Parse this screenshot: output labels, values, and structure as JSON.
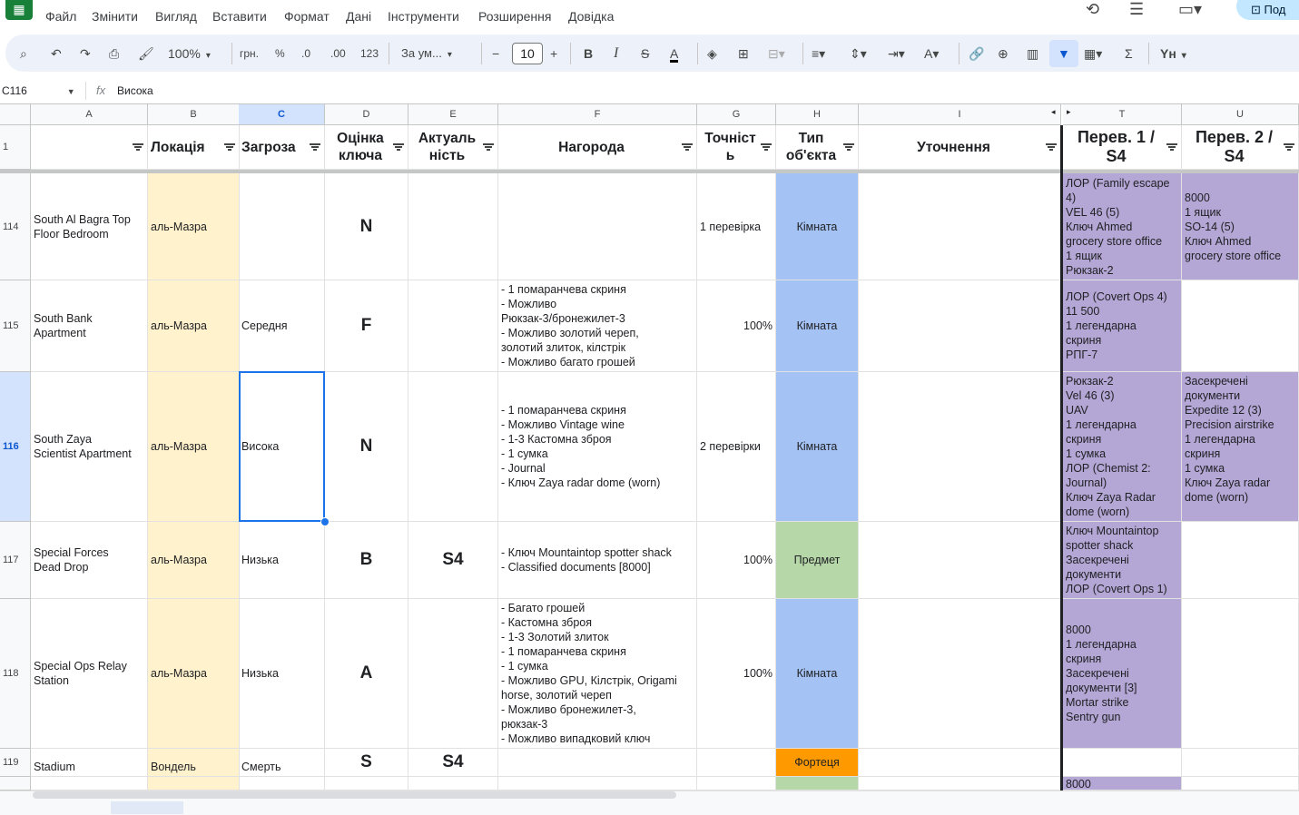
{
  "menu": [
    "Файл",
    "Змінити",
    "Вигляд",
    "Вставити",
    "Формат",
    "Дані",
    "Інструменти",
    "Розширення",
    "Довідка"
  ],
  "share_label": "Под",
  "toolbar": {
    "zoom": "100%",
    "currency": "грн.",
    "percent": "%",
    "dec_decrease": ".0",
    "dec_increase": ".00",
    "number_format": "123",
    "font": "За ум...",
    "font_size": "10",
    "bold": "B",
    "italic": "I",
    "strike": "S",
    "text_color": "A",
    "sum": "Σ",
    "input_tools": "Yн"
  },
  "formula_bar": {
    "cell_ref": "C116",
    "fx": "fx",
    "value": "Висока"
  },
  "columns": [
    "A",
    "B",
    "C",
    "D",
    "E",
    "F",
    "G",
    "H",
    "I",
    "T",
    "U"
  ],
  "header_row": {
    "num": "1",
    "A": "",
    "B": "Локація",
    "C": "Загроза",
    "D": "Оцінка\nключа",
    "E": "Актуаль\nність",
    "F": "Нагорода",
    "G": "Точніст\nь",
    "H": "Тип\nоб'єкта",
    "I": "Уточнення",
    "T": "Перев. 1 /\nS4",
    "U": "Перев. 2 /\nS4"
  },
  "rows": [
    {
      "num": "114",
      "A": "South Al Bagra Top\nFloor Bedroom",
      "B": "аль-Мазра",
      "C": "",
      "D": "N",
      "E": "",
      "F": "",
      "G": "1 перевірка",
      "H": "Кімната",
      "T": "ЛОР (Family escape\n4)\nVEL 46 (5)\nКлюч Ahmed\ngrocery store office\n1 ящик\nРюкзак-2",
      "U": "8000\n1 ящик\nSO-14 (5)\nКлюч Ahmed\ngrocery store office"
    },
    {
      "num": "115",
      "A": "South Bank\nApartment",
      "B": "аль-Мазра",
      "C": "Середня",
      "D": "F",
      "E": "",
      "F": "- 1 помаранчева скриня\n- Можливо\nРюкзак-3/бронежилет-3\n- Можливо золотий череп,\nзолотий злиток, кілстрік\n- Можливо багато грошей",
      "G": "100%",
      "H": "Кімната",
      "T": "ЛОР (Covert Ops 4)\n11 500\n1 легендарна\nскриня\nРПГ-7",
      "U": ""
    },
    {
      "num": "116",
      "A": "South Zaya\nScientist Apartment",
      "B": "аль-Мазра",
      "C": "Висока",
      "D": "N",
      "E": "",
      "F": "- 1 помаранчева скриня\n- Можливо Vintage wine\n- 1-3 Кастомна зброя\n- 1 сумка\n- Journal\n- Ключ Zaya radar dome (worn)",
      "G": "2 перевірки",
      "H": "Кімната",
      "T": "Рюкзак-2\nVel 46 (3)\nUAV\n1 легендарна\nскриня\n1 сумка\nЛОР (Chemist 2:\nJournal)\nКлюч Zaya Radar\ndome (worn)",
      "U": "Засекречені\nдокументи\nExpedite 12 (3)\nPrecision airstrike\n1 легендарна\nскриня\n1 сумка\nКлюч Zaya radar\ndome (worn)"
    },
    {
      "num": "117",
      "A": "Special Forces\nDead Drop",
      "B": "аль-Мазра",
      "C": "Низька",
      "D": "B",
      "E": "S4",
      "F": "- Ключ Mountaintop spotter shack\n- Classified documents [8000]",
      "G": "100%",
      "H": "Предмет",
      "T": "Ключ Mountaintop\nspotter shack\nЗасекречені\nдокументи\nЛОР (Covert Ops 1)",
      "U": ""
    },
    {
      "num": "118",
      "A": "Special Ops Relay\nStation",
      "B": "аль-Мазра",
      "C": "Низька",
      "D": "A",
      "E": "",
      "F": "- Багато грошей\n- Кастомна зброя\n- 1-3 Золотий злиток\n- 1 помаранчева скриня\n- 1 сумка\n- Можливо GPU, Кілстрік, Origami\nhorse, золотий череп\n- Можливо бронежилет-3,\nрюкзак-3\n- Можливо випадковий ключ",
      "G": "100%",
      "H": "Кімната",
      "T": "8000\n1 легендарна\nскриня\nЗасекречені\nдокументи [3]\nMortar strike\nSentry gun",
      "U": ""
    },
    {
      "num": "119",
      "A": "Stadium",
      "B": "Вондель",
      "C": "Смерть",
      "D": "S",
      "E": "S4",
      "F": "",
      "G": "",
      "H": "Фортеця",
      "T": "",
      "U": ""
    },
    {
      "num": "",
      "A": "",
      "B": "",
      "C": "",
      "D": "",
      "E": "",
      "F": "",
      "G": "",
      "H": "",
      "T": "8000",
      "U": ""
    }
  ],
  "colors": {
    "location_fill": "#fff2cc",
    "room_fill": "#a4c2f4",
    "item_fill": "#b6d7a8",
    "fortress_fill": "#ff9900",
    "check_fill": "#b4a7d6"
  }
}
